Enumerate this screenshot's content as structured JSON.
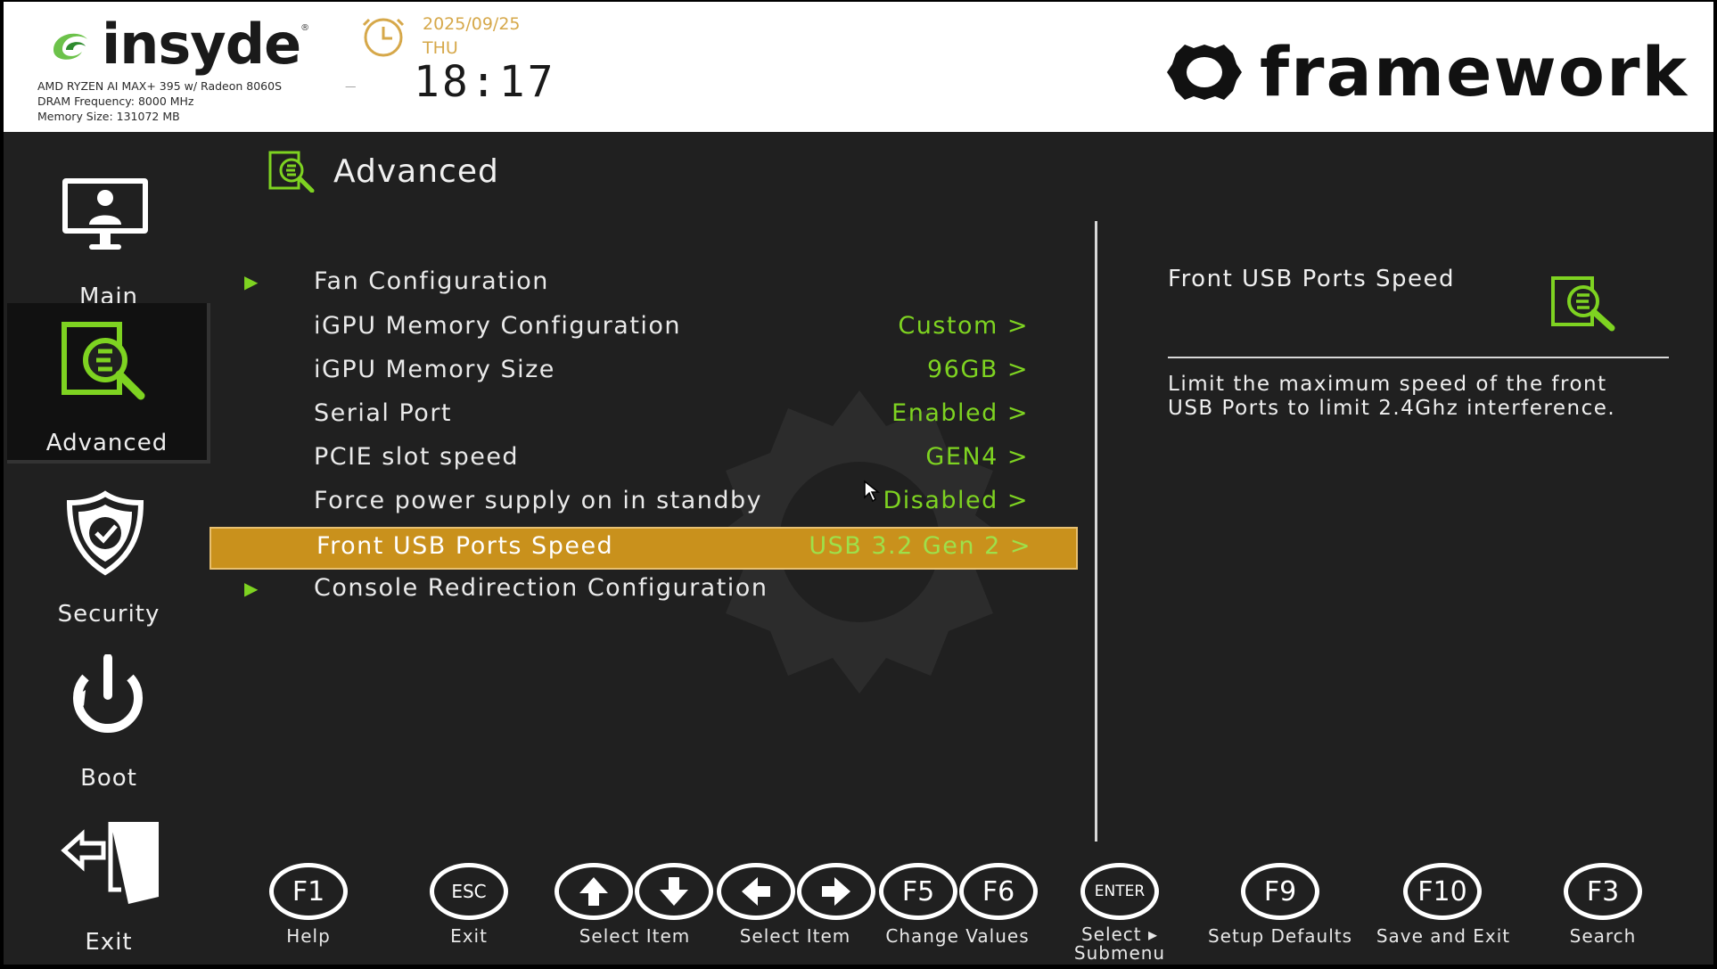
{
  "header": {
    "brand": "insyde",
    "cpu": "AMD RYZEN AI MAX+ 395 w/ Radeon 8060S",
    "dram": "DRAM Frequency: 8000 MHz",
    "memory": "Memory Size: 131072 MB",
    "separator": "—",
    "date": "2025/09/25",
    "day": "THU",
    "time": "18:17",
    "vendor": "framework"
  },
  "sidebar": {
    "items": [
      {
        "label": "Main",
        "icon": "monitor-user-icon"
      },
      {
        "label": "Advanced",
        "icon": "advanced-search-icon",
        "active": true
      },
      {
        "label": "Security",
        "icon": "shield-check-icon"
      },
      {
        "label": "Boot",
        "icon": "power-icon"
      },
      {
        "label": "Exit",
        "icon": "exit-door-icon"
      }
    ]
  },
  "section": {
    "title": "Advanced"
  },
  "menu": [
    {
      "label": "Fan Configuration",
      "value": "",
      "submenu": true
    },
    {
      "label": "iGPU Memory Configuration",
      "value": "Custom >"
    },
    {
      "label": "iGPU Memory Size",
      "value": "96GB >"
    },
    {
      "label": "Serial Port",
      "value": "Enabled >"
    },
    {
      "label": "PCIE slot speed",
      "value": "GEN4 >"
    },
    {
      "label": "Force power supply on in standby",
      "value": "Disabled >"
    },
    {
      "label": "Front USB Ports Speed",
      "value": "USB 3.2 Gen 2 >",
      "selected": true
    },
    {
      "label": "Console Redirection Configuration",
      "value": "",
      "submenu": true
    }
  ],
  "help": {
    "title": "Front USB Ports Speed",
    "description": "Limit the maximum speed of the front USB Ports to limit 2.4Ghz interference."
  },
  "footer": {
    "keys": [
      {
        "key": "F1",
        "label": "Help"
      },
      {
        "key": "ESC",
        "label": "Exit"
      },
      {
        "key": "up-arrow-icon",
        "label": "Select Item"
      },
      {
        "key": "left-right-arrow-icon",
        "label": "Select Item"
      },
      {
        "key": "F5 F6",
        "label": "Change Values"
      },
      {
        "key": "ENTER",
        "label": "Select ▸ Submenu"
      },
      {
        "key": "F9",
        "label": "Setup Defaults"
      },
      {
        "key": "F10",
        "label": "Save and Exit"
      },
      {
        "key": "F3",
        "label": "Search"
      }
    ],
    "key_f1": "F1",
    "key_esc": "ESC",
    "key_f5": "F5",
    "key_f6": "F6",
    "key_enter": "ENTER",
    "key_f9": "F9",
    "key_f10": "F10",
    "key_f3": "F3",
    "enter_label_1": "Select ▸",
    "enter_label_2": "Submenu"
  },
  "colors": {
    "accent_green": "#7ed321",
    "selection": "#c9911c",
    "date": "#d6a84a",
    "background": "#202020"
  }
}
